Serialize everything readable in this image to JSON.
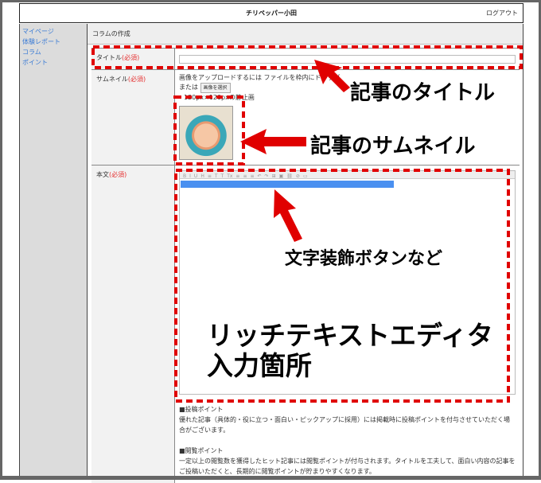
{
  "header": {
    "title": "チリペッパー小田",
    "logout": "ログアウト"
  },
  "sidebar": {
    "items": [
      {
        "label": "マイページ"
      },
      {
        "label": "体験レポート"
      },
      {
        "label": "コラム"
      },
      {
        "label": "ポイント"
      }
    ]
  },
  "breadcrumb": "コラムの作成",
  "form": {
    "title_label": "タイトル",
    "required": "(必須)",
    "thumb_label": "サムネイル",
    "thumb_hint": "画像をアップロードするには ファイルを枠内にドラッグ",
    "thumb_or": "または",
    "thumb_button": "画像を選択",
    "thumb_size": "120px×120pxの静止画",
    "body_label": "本文",
    "toolbar": [
      "B",
      "I",
      "U",
      "H",
      "≡",
      "T",
      "T",
      "Tx",
      "≡",
      "≡",
      "≡",
      "↶",
      "↷",
      "⊞",
      "▣",
      "⛓",
      "⊘",
      "▭"
    ]
  },
  "notes": {
    "post_title": "■投稿ポイント",
    "post_text": "優れた記事（具体的・役に立つ・面白い・ピックアップに採用）には掲載時に投稿ポイントを付与させていただく場合がございます。",
    "view_title": "■閲覧ポイント",
    "view_text": "一定以上の閲覧数を獲得したヒット記事には閲覧ポイントが付与されます。タイトルを工夫して、面白い内容の記事をご投稿いただくと、長期的に閲覧ポイントが貯まりやすくなります。"
  },
  "annotations": {
    "title": "記事のタイトル",
    "thumbnail": "記事のサムネイル",
    "buttons": "文字装飾ボタンなど",
    "editor_line1": "リッチテキストエディタ",
    "editor_line2": "入力箇所"
  },
  "colors": {
    "annotation": "#e00000",
    "link": "#3a7bd5",
    "required": "#e53030",
    "bar": "#4a90f0"
  }
}
